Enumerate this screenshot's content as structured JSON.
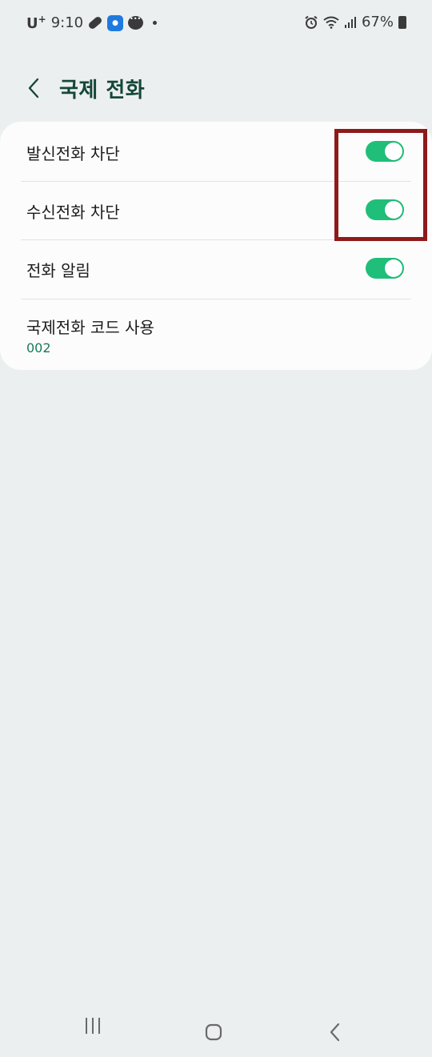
{
  "status_bar": {
    "carrier": "U",
    "carrier_sup": "+",
    "time": "9:10",
    "battery": "67%",
    "icons": [
      "pill-icon",
      "app-notification-icon",
      "chat-icon",
      "dot-icon",
      "alarm-icon",
      "wifi-icon",
      "signal-icon",
      "battery-icon"
    ]
  },
  "header": {
    "title": "국제 전화",
    "back_icon": "chevron-left-icon"
  },
  "settings": [
    {
      "label": "발신전화 차단",
      "toggle": true
    },
    {
      "label": "수신전화 차단",
      "toggle": true
    },
    {
      "label": "전화 알림",
      "toggle": true
    },
    {
      "label": "국제전화 코드 사용",
      "sub": "002"
    }
  ],
  "colors": {
    "accent": "#1fbf7a",
    "title": "#15473a",
    "subtext": "#1a7a5c",
    "highlight": "#8e1a1a",
    "background": "#eceff0"
  },
  "nav": {
    "icons": [
      "recent-apps-icon",
      "home-icon",
      "back-icon"
    ]
  }
}
